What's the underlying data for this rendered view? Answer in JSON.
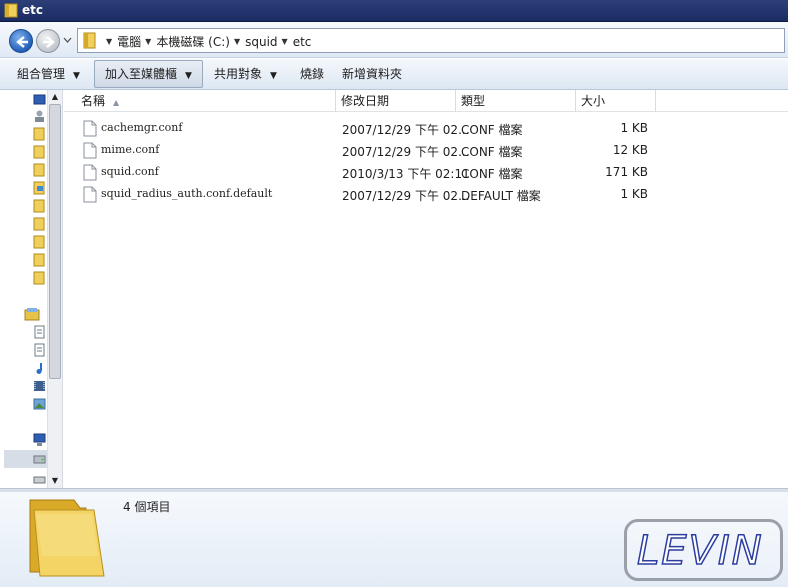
{
  "window": {
    "title": "etc"
  },
  "address": {
    "crumbs": [
      "電腦",
      "本機磁碟 (C:)",
      "squid",
      "etc"
    ]
  },
  "toolbar": {
    "organize": "組合管理",
    "add_to_library": "加入至媒體櫃",
    "share_with": "共用對象",
    "burn": "燒錄",
    "new_folder": "新增資料夾"
  },
  "columns": {
    "name": "名稱",
    "date_modified": "修改日期",
    "type": "類型",
    "size": "大小"
  },
  "files": [
    {
      "name": "cachemgr.conf",
      "date": "2007/12/29 下午 02...",
      "type": "CONF 檔案",
      "size": "1 KB"
    },
    {
      "name": "mime.conf",
      "date": "2007/12/29 下午 02...",
      "type": "CONF 檔案",
      "size": "12 KB"
    },
    {
      "name": "squid.conf",
      "date": "2010/3/13 下午 02:11",
      "type": "CONF 檔案",
      "size": "171 KB"
    },
    {
      "name": "squid_radius_auth.conf.default",
      "date": "2007/12/29 下午 02...",
      "type": "DEFAULT 檔案",
      "size": "1 KB"
    }
  ],
  "details": {
    "item_count": "4 個項目"
  },
  "watermark": {
    "text": "LEVIN"
  },
  "colors": {
    "accent": "#2360b9",
    "titlebar": "#1b2c63",
    "folder": "#e8c34a"
  }
}
